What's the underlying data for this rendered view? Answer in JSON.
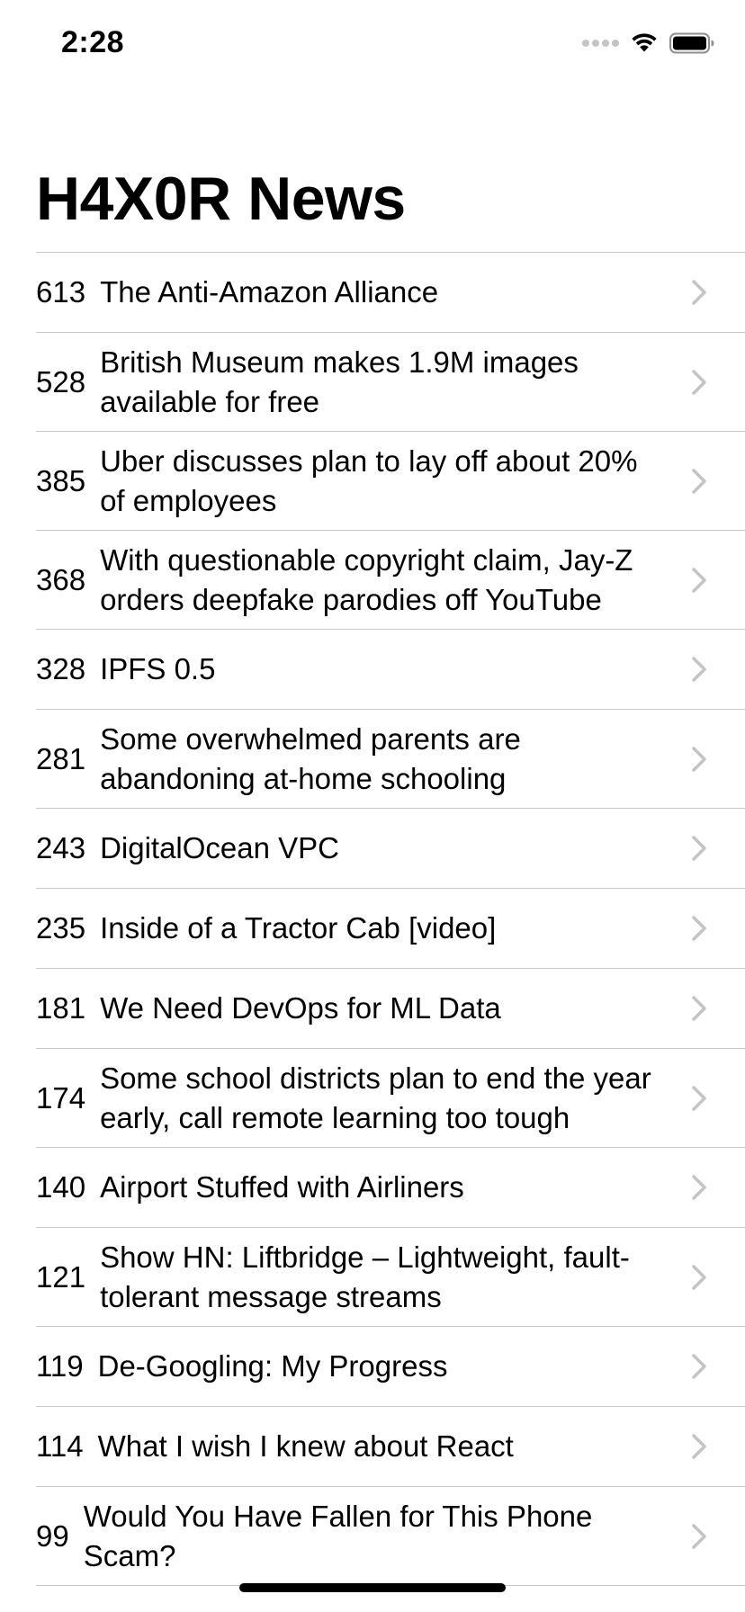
{
  "status_bar": {
    "time": "2:28",
    "icons": [
      "signal-dots-icon",
      "wifi-icon",
      "battery-icon"
    ]
  },
  "navigation": {
    "title": "H4X0R News"
  },
  "stories": [
    {
      "score": "613",
      "title": "The Anti-Amazon Alliance"
    },
    {
      "score": "528",
      "title": "British Museum makes 1.9M images available for free"
    },
    {
      "score": "385",
      "title": "Uber discusses plan to lay off about 20% of employees"
    },
    {
      "score": "368",
      "title": "With questionable copyright claim, Jay-Z orders deepfake parodies off YouTube"
    },
    {
      "score": "328",
      "title": "IPFS 0.5"
    },
    {
      "score": "281",
      "title": "Some overwhelmed parents are abandoning at-home schooling"
    },
    {
      "score": "243",
      "title": "DigitalOcean VPC"
    },
    {
      "score": "235",
      "title": "Inside of a Tractor Cab [video]"
    },
    {
      "score": "181",
      "title": "We Need DevOps for ML Data"
    },
    {
      "score": "174",
      "title": "Some school districts plan to end the year early, call remote learning too tough"
    },
    {
      "score": "140",
      "title": "Airport Stuffed with Airliners"
    },
    {
      "score": "121",
      "title": "Show HN: Liftbridge – Lightweight, fault-tolerant message streams"
    },
    {
      "score": "119",
      "title": "De-Googling: My Progress"
    },
    {
      "score": "114",
      "title": "What I wish I knew about React"
    },
    {
      "score": "99",
      "title": "Would You Have Fallen for This Phone Scam?"
    }
  ],
  "colors": {
    "separator": "#c8c7cc",
    "chevron": "#c4c4c7",
    "text": "#000000",
    "background": "#ffffff"
  }
}
